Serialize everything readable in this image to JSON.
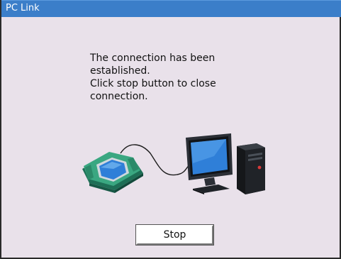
{
  "window": {
    "title": "PC Link"
  },
  "message": {
    "line1": "The connection has been",
    "line2": "established.",
    "line3": "Click stop button to close",
    "line4": "connection."
  },
  "illustration": {
    "device_icon": "diagnostic-scanner-icon",
    "computer_icon": "desktop-computer-icon"
  },
  "actions": {
    "stop_label": "Stop"
  },
  "colors": {
    "titlebar": "#3b7ec9",
    "background": "#e9e1ea",
    "device_body": "#2e9a7a",
    "screen": "#2f7fd8"
  }
}
